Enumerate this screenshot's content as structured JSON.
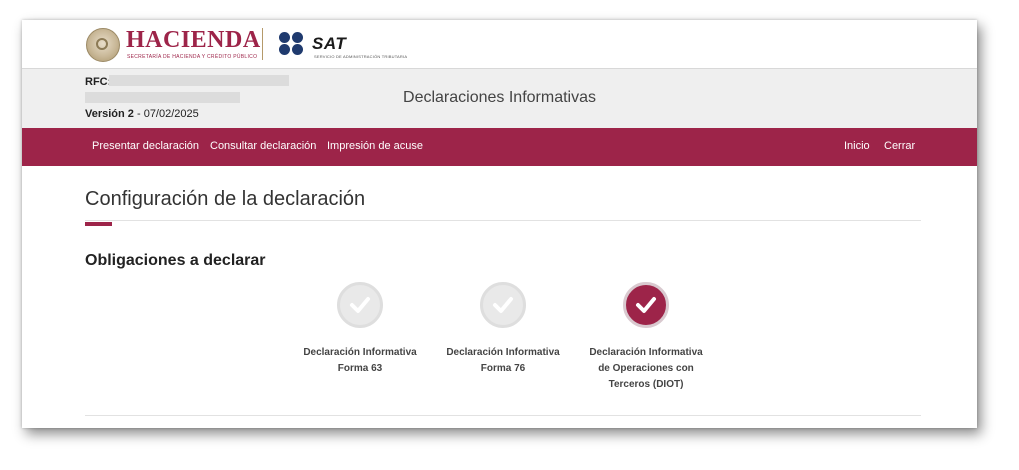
{
  "branding": {
    "hacienda_title": "HACIENDA",
    "hacienda_subtitle": "SECRETARÍA DE HACIENDA Y CRÉDITO PÚBLICO",
    "sat_title": "SAT",
    "sat_subtitle": "SERVICIO DE ADMINISTRACIÓN TRIBUTARIA"
  },
  "info": {
    "rfc_label": "RFC:",
    "version_label": "Versión 2",
    "version_date": " - 07/02/2025",
    "app_title": "Declaraciones Informativas"
  },
  "nav": {
    "left": [
      "Presentar declaración",
      "Consultar declaración",
      "Impresión de acuse"
    ],
    "right": [
      "Inicio",
      "Cerrar"
    ]
  },
  "page": {
    "title": "Configuración de la declaración",
    "section_title": "Obligaciones a declarar"
  },
  "obligations": [
    {
      "line1": "Declaración Informativa",
      "line2": "Forma 63",
      "line3": "",
      "line4": "",
      "selected": false
    },
    {
      "line1": "Declaración Informativa",
      "line2": "Forma 76",
      "line3": "",
      "line4": "",
      "selected": false
    },
    {
      "line1": "Declaración Informativa",
      "line2": "de Operaciones con",
      "line3": "Terceros (DIOT)",
      "line4": "",
      "selected": true
    }
  ],
  "colors": {
    "brand": "#9d2449",
    "sat_blue": "#1f3a6e"
  }
}
